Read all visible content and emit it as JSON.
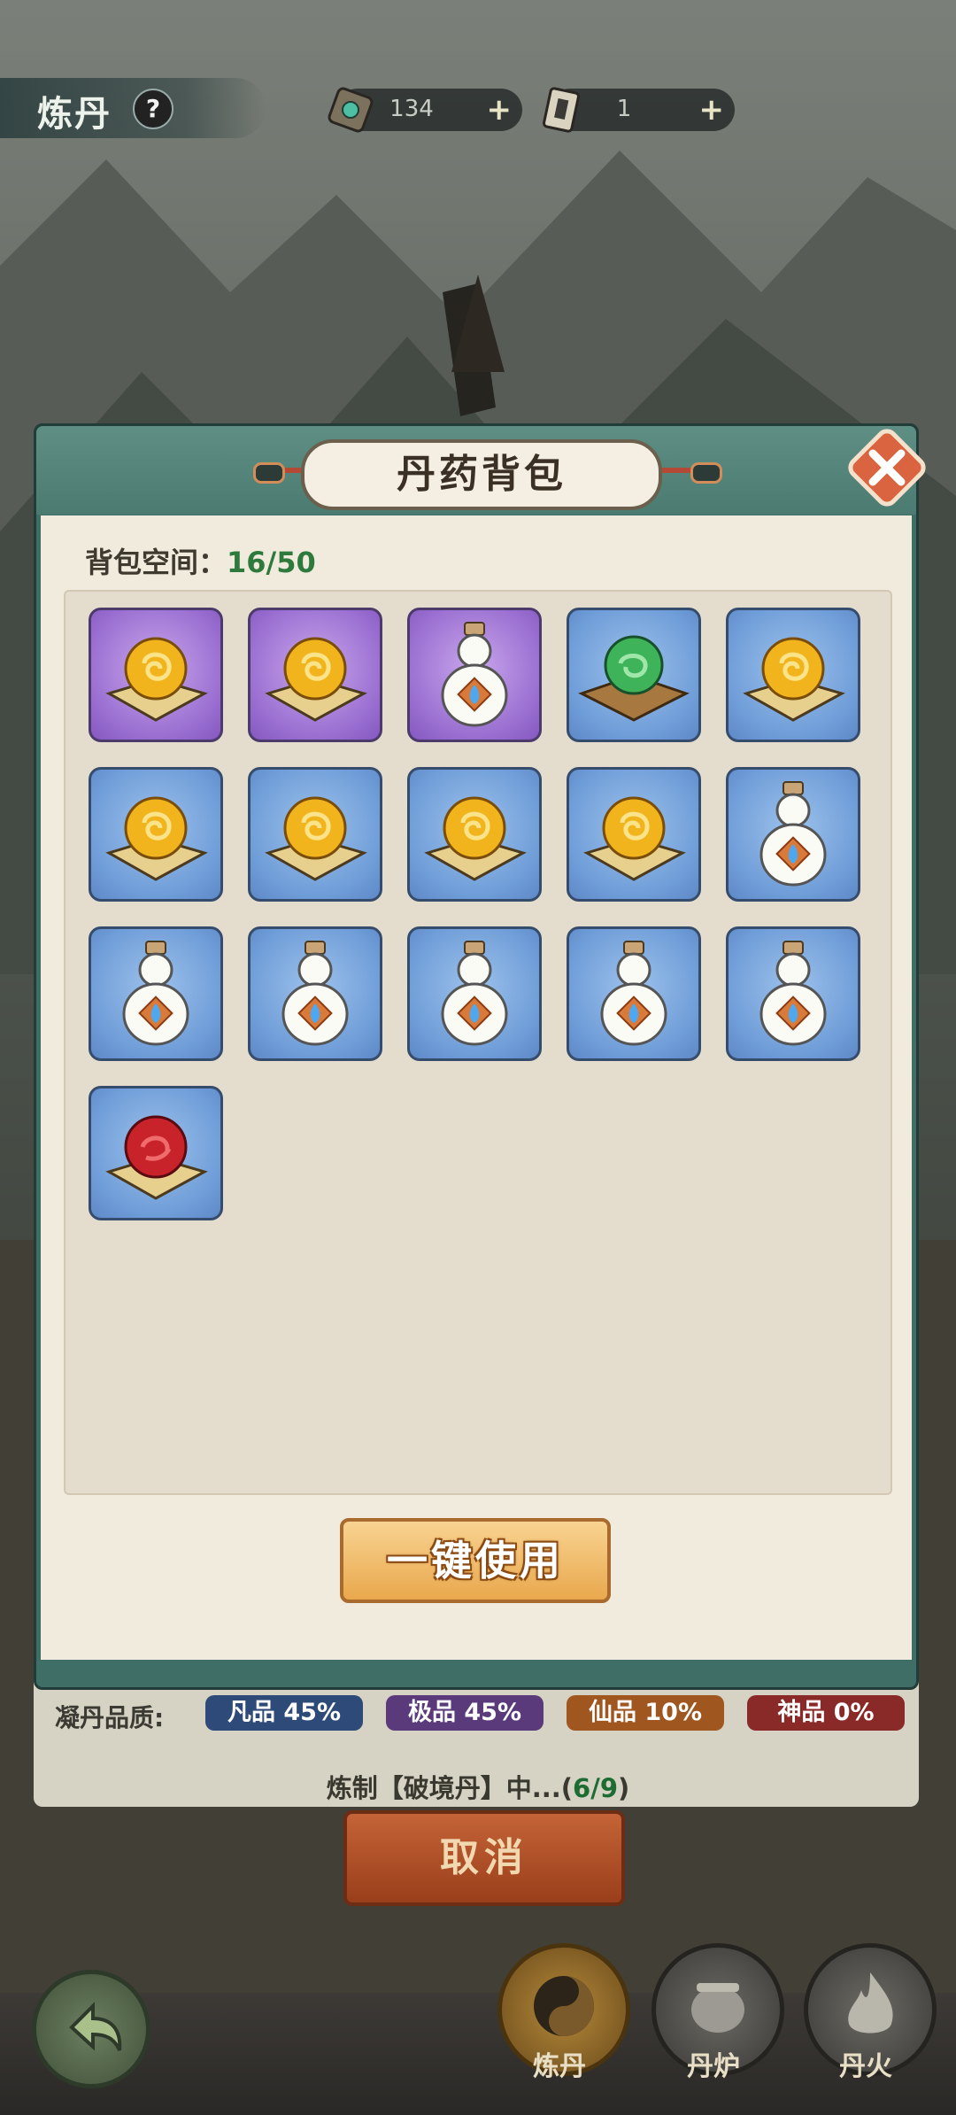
{
  "top_bar": {
    "title": "炼丹",
    "help": "?",
    "currency_1": "134",
    "currency_2": "1",
    "plus": "+"
  },
  "modal": {
    "title": "丹药背包",
    "space_label": "背包空间：",
    "space_value": "16/50",
    "use_all_button": "一键使用",
    "items": [
      {
        "bg": "purple",
        "icon": "yellow-pill-icon"
      },
      {
        "bg": "purple",
        "icon": "yellow-pill-icon"
      },
      {
        "bg": "purple",
        "icon": "white-gourd-icon"
      },
      {
        "bg": "blue",
        "icon": "green-pill-icon"
      },
      {
        "bg": "blue",
        "icon": "yellow-pill-icon"
      },
      {
        "bg": "blue",
        "icon": "yellow-pill-icon"
      },
      {
        "bg": "blue",
        "icon": "yellow-pill-icon"
      },
      {
        "bg": "blue",
        "icon": "yellow-pill-icon"
      },
      {
        "bg": "blue",
        "icon": "yellow-pill-icon"
      },
      {
        "bg": "blue",
        "icon": "white-gourd-icon"
      },
      {
        "bg": "blue",
        "icon": "white-gourd-icon"
      },
      {
        "bg": "blue",
        "icon": "white-gourd-icon"
      },
      {
        "bg": "blue",
        "icon": "white-gourd-icon"
      },
      {
        "bg": "blue",
        "icon": "white-gourd-icon"
      },
      {
        "bg": "blue",
        "icon": "white-gourd-icon"
      },
      {
        "bg": "blue",
        "icon": "red-pill-icon"
      }
    ]
  },
  "quality": {
    "label": "凝丹品质:",
    "badges": [
      {
        "text": "凡品 45%",
        "color": "#2e4a78"
      },
      {
        "text": "极品 45%",
        "color": "#5a3a7a"
      },
      {
        "text": "仙品 10%",
        "color": "#a0561f"
      },
      {
        "text": "神品 0%",
        "color": "#8a2a28"
      }
    ]
  },
  "refine": {
    "prefix": "炼制【破境丹】中...(",
    "progress": "6/9",
    "suffix": ")"
  },
  "cancel_button": "取消",
  "nav": {
    "refine": "炼丹",
    "furnace": "丹炉",
    "fire": "丹火"
  }
}
